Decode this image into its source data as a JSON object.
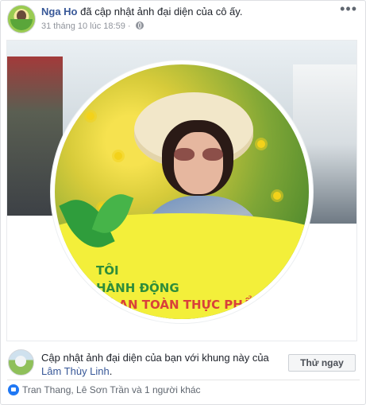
{
  "post": {
    "author": "Nga Ho",
    "action": "đã cập nhật ảnh đại diện của cô ấy.",
    "timestamp": "31 tháng 10 lúc 18:59",
    "privacy_dot": "·",
    "privacy_icon": "globe-icon",
    "more_label": "•••"
  },
  "frame_banner": {
    "line1": "TÔI",
    "line2": "HÀNH ĐỘNG",
    "line3": "VÌ AN TOÀN THỰC PHẨM",
    "line1_color": "#2f8d3a",
    "line3_color": "#d9403a",
    "accent": "#f3ef3a"
  },
  "promo": {
    "text": "Cập nhật ảnh đại diện của bạn với khung này của",
    "creator": "Lâm Thùy Linh",
    "period": ".",
    "button_label": "Thử ngay"
  },
  "reactions": {
    "icon": "like-icon",
    "text": "Tran Thang, Lê Sơn Trần và 1 người khác"
  },
  "colors": {
    "link": "#385898",
    "secondary": "#90949c",
    "like_blue": "#2078f4"
  }
}
